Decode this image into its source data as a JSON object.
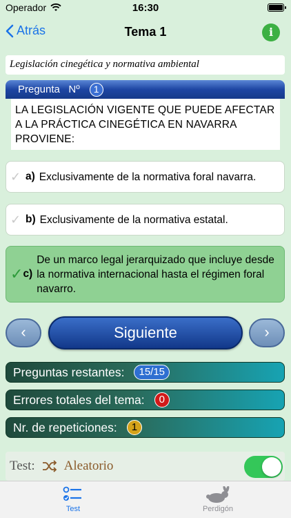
{
  "status_bar": {
    "carrier": "Operador",
    "time": "16:30"
  },
  "nav": {
    "back_label": "Atrás",
    "title": "Tema 1",
    "info_label": "i"
  },
  "topic": "Legislación cinegética y normativa ambiental",
  "question": {
    "header_label": "Pregunta   Nº",
    "number": "1",
    "text": "LA LEGISLACIÓN VIGENTE QUE PUEDE AFECTAR A LA PRÁCTICA CINEGÉTICA EN NAVARRA PROVIENE:"
  },
  "answers": [
    {
      "letter": "a)",
      "text": "Exclusivamente de la normativa foral navarra.",
      "correct": false
    },
    {
      "letter": "b)",
      "text": "Exclusivamente de la normativa estatal.",
      "correct": false
    },
    {
      "letter": "c)",
      "text": "De un marco legal jerarquizado que incluye desde la normativa internacional hasta el régimen foral navarro.",
      "correct": true
    }
  ],
  "controls": {
    "next_label": "Siguiente",
    "prev_arrow": "‹",
    "next_arrow": "›"
  },
  "stats": {
    "remaining_label": "Preguntas restantes:",
    "remaining_value": "15/15",
    "errors_label": "Errores totales del tema:",
    "errors_value": "0",
    "repetitions_label": "Nr. de repeticiones:",
    "repetitions_value": "1"
  },
  "test_mode": {
    "label": "Test:",
    "mode": "Aleatorio",
    "toggle_on": true
  },
  "tabs": [
    {
      "label": "Test",
      "icon": "list-icon",
      "active": true
    },
    {
      "label": "Perdigón",
      "icon": "rabbit-icon",
      "active": false
    }
  ],
  "colors": {
    "accent": "#1a73e8",
    "correct": "#8fd193",
    "toggle": "#34c759",
    "background": "#d9f0dc"
  }
}
